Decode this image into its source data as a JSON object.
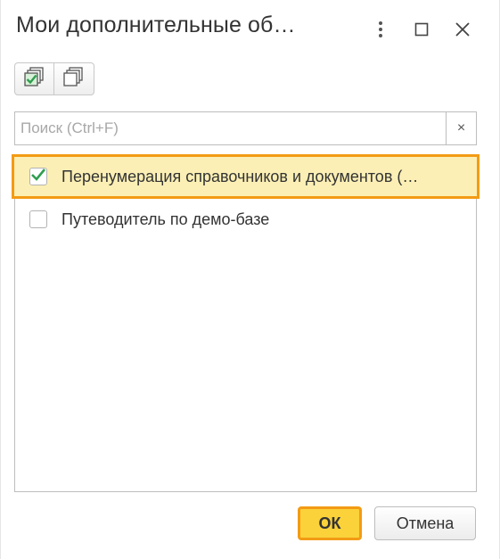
{
  "window": {
    "title": "Мои дополнительные об…"
  },
  "toolbar": {
    "check_all_icon": "check-all-icon",
    "uncheck_all_icon": "uncheck-all-icon"
  },
  "search": {
    "placeholder": "Поиск (Ctrl+F)",
    "value": "",
    "clear_label": "×"
  },
  "list": {
    "items": [
      {
        "label": "Перенумерация справочников и документов (…",
        "checked": true,
        "selected": true
      },
      {
        "label": "Путеводитель по демо-базе",
        "checked": false,
        "selected": false
      }
    ]
  },
  "footer": {
    "ok_label": "ОК",
    "cancel_label": "Отмена"
  },
  "colors": {
    "accent": "#f39b15",
    "selection_bg": "#fbefb5",
    "ok_bg": "#fbd23a",
    "check": "#2f9e4f"
  }
}
